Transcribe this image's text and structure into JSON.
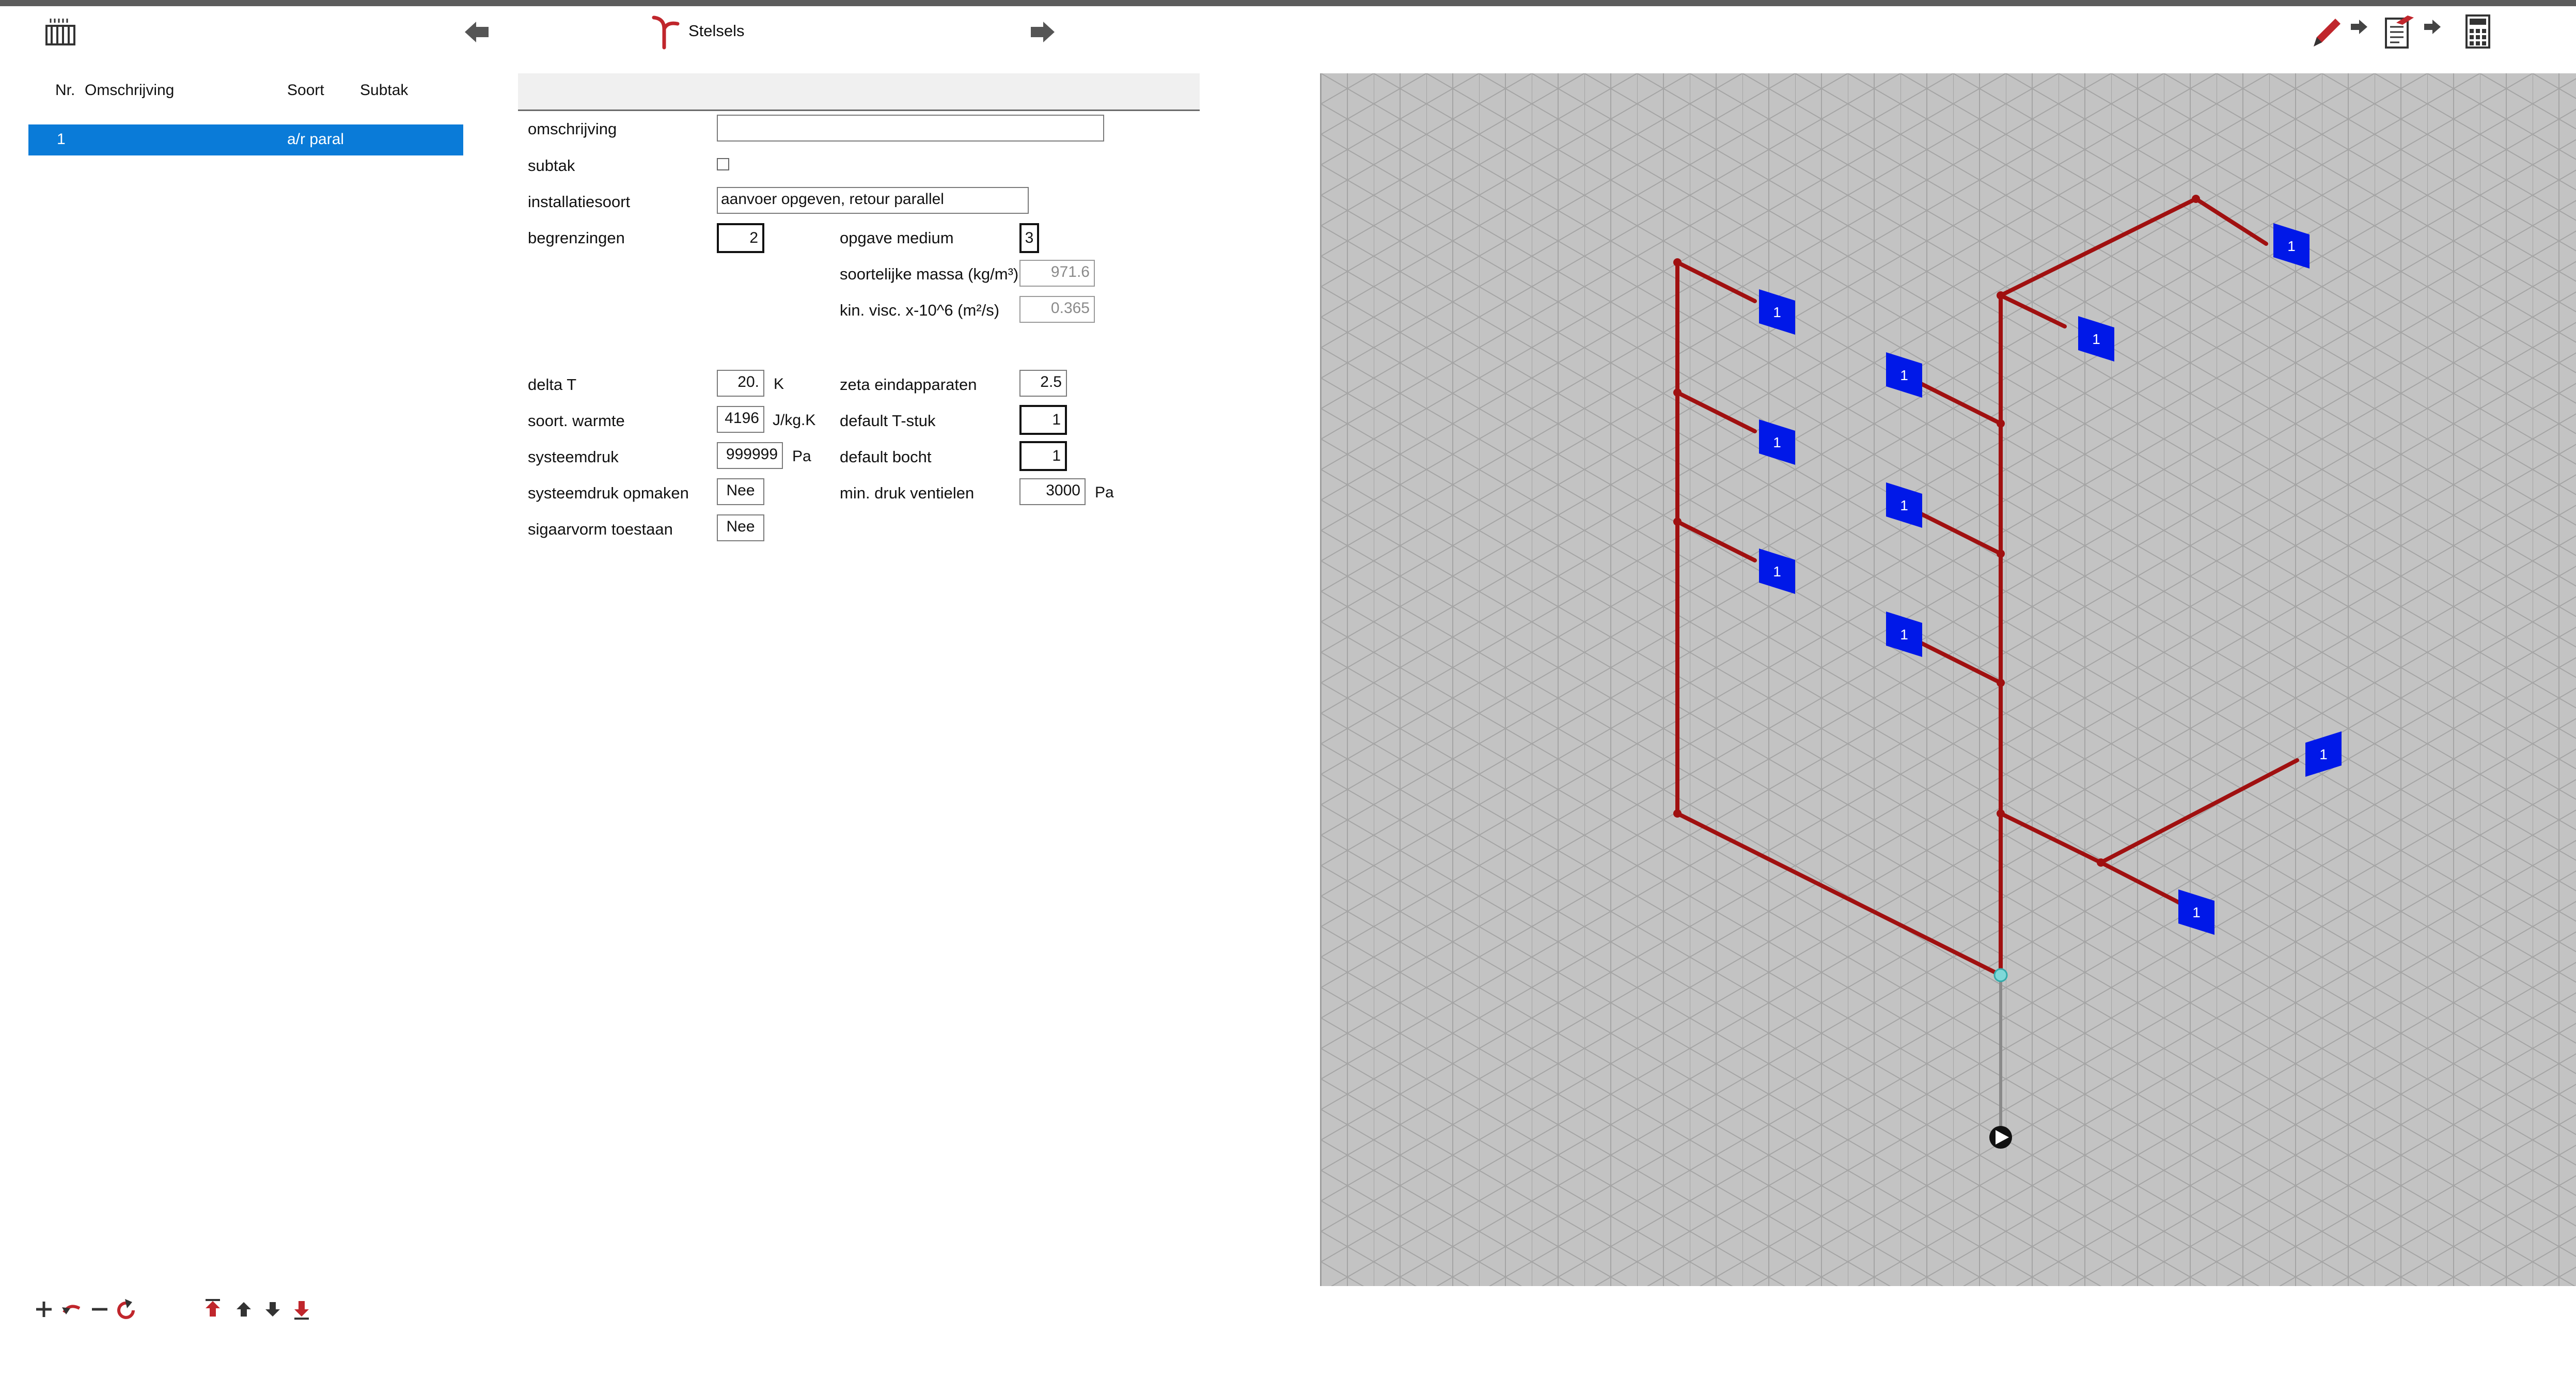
{
  "toolbar": {
    "title": "Stelsels",
    "icons": {
      "radiator": "radiator-icon",
      "back": "arrow-left-icon",
      "forward": "arrow-right-icon",
      "stelsels": "pipe-branch-icon",
      "edit": "pencil-icon",
      "report": "document-icon",
      "calculator": "calculator-icon"
    }
  },
  "list": {
    "headers": {
      "nr": "Nr.",
      "omschrijving": "Omschrijving",
      "soort": "Soort",
      "subtak": "Subtak"
    },
    "rows": [
      {
        "nr": "1",
        "omschrijving": "",
        "soort": "a/r paral",
        "subtak": ""
      }
    ]
  },
  "form": {
    "omschrijving": {
      "label": "omschrijving",
      "value": ""
    },
    "subtak": {
      "label": "subtak",
      "checked": false
    },
    "installatiesoort": {
      "label": "installatiesoort",
      "value": "aanvoer opgeven, retour parallel"
    },
    "begrenzingen": {
      "label": "begrenzingen",
      "value": "2"
    },
    "opgave_medium": {
      "label": "opgave medium",
      "value": "3"
    },
    "soortelijke_massa": {
      "label": "soortelijke massa (kg/m³)",
      "value": "971.6"
    },
    "kin_visc": {
      "label": "kin. visc. x-10^6 (m²/s)",
      "value": "0.365"
    },
    "delta_t": {
      "label": "delta T",
      "value": "20.",
      "unit": "K"
    },
    "zeta": {
      "label": "zeta eindapparaten",
      "value": "2.5"
    },
    "soort_warmte": {
      "label": "soort. warmte",
      "value": "4196",
      "unit": "J/kg.K"
    },
    "default_tstuk": {
      "label": "default T-stuk",
      "value": "1"
    },
    "systeemdruk": {
      "label": "systeemdruk",
      "value": "999999",
      "unit": "Pa"
    },
    "default_bocht": {
      "label": "default bocht",
      "value": "1"
    },
    "systeemdruk_opmaken": {
      "label": "systeemdruk opmaken",
      "value": "Nee"
    },
    "min_druk": {
      "label": "min. druk ventielen",
      "value": "3000",
      "unit": "Pa"
    },
    "sigaarvorm": {
      "label": "sigaarvorm toestaan",
      "value": "Nee"
    }
  },
  "diagram": {
    "radiator_label": "1",
    "pipe_color": "#a01010",
    "radiator_color": "#0018e8",
    "grid_color": "#c3c3c3"
  },
  "bottom_icons": [
    "plus-icon",
    "undo-icon",
    "minus-icon",
    "refresh-icon",
    "move-top-icon",
    "move-up-icon",
    "move-down-icon",
    "move-bottom-icon"
  ],
  "colors": {
    "selection": "#0a7bd8",
    "accent": "#c0262c"
  }
}
